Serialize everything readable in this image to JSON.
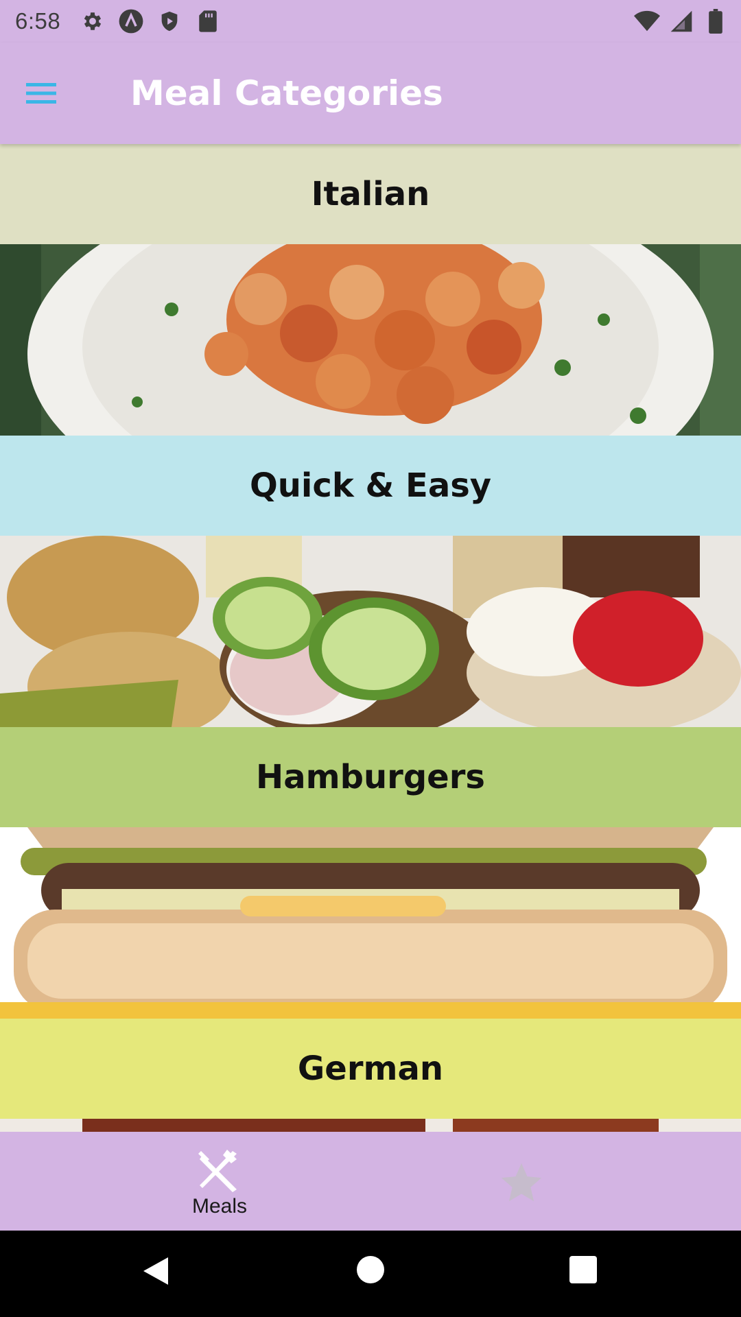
{
  "status_bar": {
    "time": "6:58",
    "icons_left": [
      "settings-gear-icon",
      "a-circle-icon",
      "play-shield-icon",
      "sd-card-icon"
    ],
    "icons_right": [
      "wifi-icon",
      "signal-icon",
      "battery-icon"
    ]
  },
  "app_bar": {
    "menu_icon": "hamburger-menu-icon",
    "title": "Meal Categories",
    "menu_icon_color": "#3ab6e6"
  },
  "categories": [
    {
      "title": "Italian",
      "header_color": "#dfe0c3",
      "image": "pasta-plate-image"
    },
    {
      "title": "Quick & Easy",
      "header_color": "#bde6ed",
      "image": "appetizer-platter-image"
    },
    {
      "title": "Hamburgers",
      "header_color": "#b4cf77",
      "image": "hamburger-image"
    },
    {
      "title": "German",
      "header_color": "#e5e87b",
      "image": "german-food-image"
    }
  ],
  "bottom_nav": {
    "items": [
      {
        "label": "Meals",
        "icon": "fork-knife-icon",
        "selected": true
      },
      {
        "label": "",
        "icon": "star-icon",
        "selected": false
      }
    ]
  },
  "system_nav": {
    "buttons": [
      "back-icon",
      "home-icon",
      "recents-icon"
    ]
  },
  "colors": {
    "app_bar_bg": "#d3b4e3",
    "title_text": "#ffffff",
    "inactive_icon": "#c6bccc"
  }
}
